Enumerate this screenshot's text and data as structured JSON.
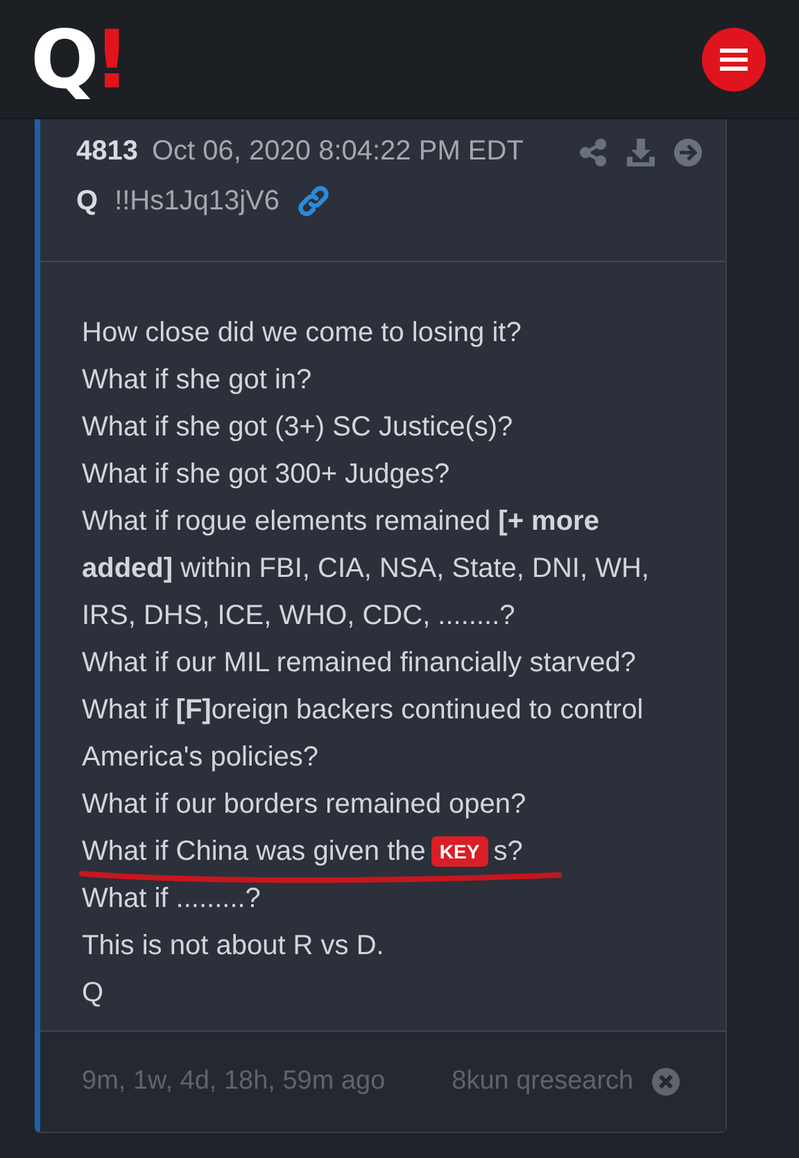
{
  "logo": {
    "letter": "Q",
    "mark": "!"
  },
  "post": {
    "number": "4813",
    "date": "Oct 06, 2020 8:04:22 PM EDT",
    "author": "Q",
    "tripcode": "!!Hs1Jq13jV6",
    "lines": [
      {
        "kind": "text",
        "text": "How close did we come to losing it?"
      },
      {
        "kind": "text",
        "text": "What if she got in?"
      },
      {
        "kind": "text",
        "text": "What if she got (3+) SC Justice(s)?"
      },
      {
        "kind": "text",
        "text": "What if she got 300+ Judges?"
      },
      {
        "kind": "text",
        "text": "What if rogue elements remained **[+ more added]** within FBI, CIA, NSA, State, DNI, WH, IRS, DHS, ICE, WHO, CDC, ........?"
      },
      {
        "kind": "text",
        "text": "What if our MIL remained financially starved?"
      },
      {
        "kind": "text",
        "text": "What if **[F]**oreign backers continued to control America's policies?"
      },
      {
        "kind": "text",
        "text": "What if our borders remained open?"
      },
      {
        "kind": "badge",
        "before": "What if China was given the",
        "badge": "KEY",
        "after": "s?"
      },
      {
        "kind": "text",
        "text": "What if .........?"
      },
      {
        "kind": "text",
        "text": "This is not about R vs D."
      },
      {
        "kind": "text",
        "text": "Q"
      }
    ],
    "age": "9m, 1w, 4d, 18h, 59m ago",
    "source": "8kun qresearch"
  }
}
